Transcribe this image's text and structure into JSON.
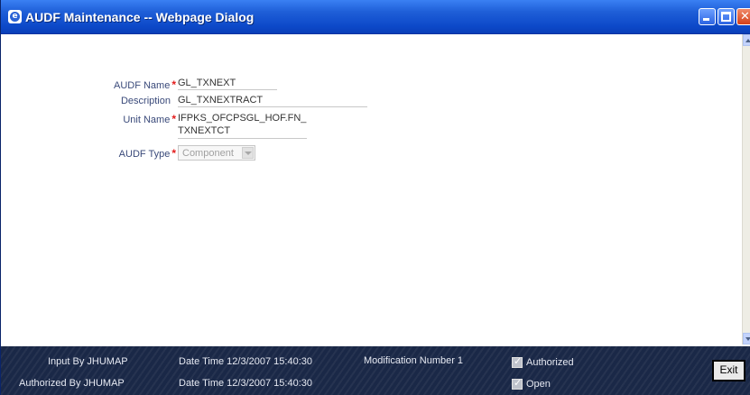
{
  "window": {
    "title": "AUDF Maintenance -- Webpage Dialog"
  },
  "form": {
    "audf_name_label": "AUDF Name",
    "audf_name_value": "GL_TXNEXT",
    "description_label": "Description",
    "description_value": "GL_TXNEXTRACT",
    "unit_name_label": "Unit Name",
    "unit_name_value_line1": "IFPKS_OFCPSGL_HOF.FN_",
    "unit_name_value_line2": "TXNEXTCT",
    "audf_type_label": "AUDF Type",
    "audf_type_value": "Component",
    "required_marker": "*"
  },
  "footer": {
    "input_by": "Input By JHUMAP",
    "authorized_by": "Authorized By JHUMAP",
    "date_time_1": "Date Time 12/3/2007 15:40:30",
    "date_time_2": "Date Time 12/3/2007 15:40:30",
    "modification_number": "Modification Number 1",
    "authorized_label": "Authorized",
    "open_label": "Open",
    "exit_label": "Exit"
  }
}
